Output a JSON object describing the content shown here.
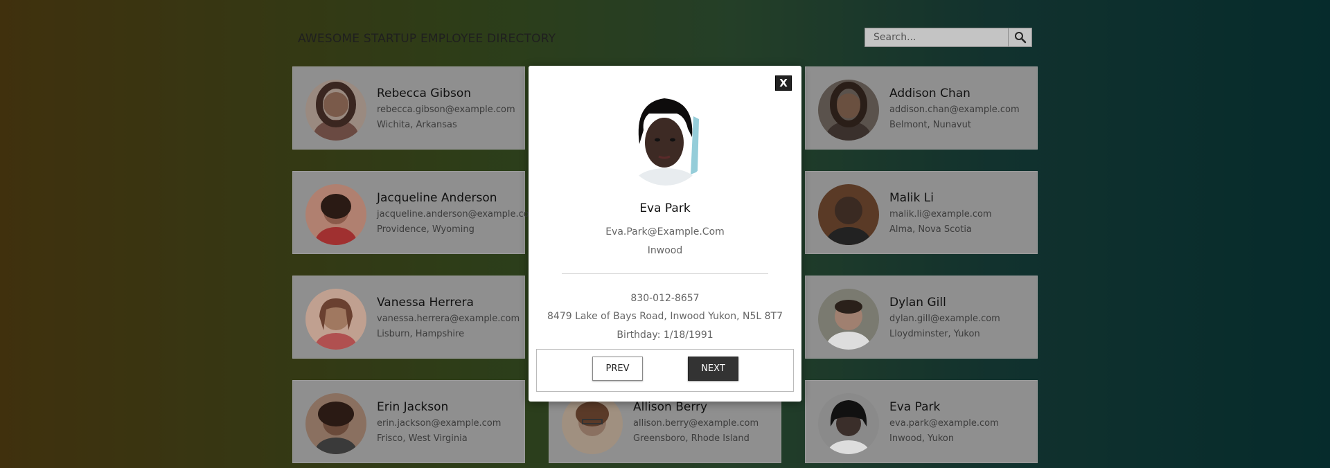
{
  "header": {
    "title": "AWESOME STARTUP EMPLOYEE DIRECTORY",
    "search_placeholder": "Search...",
    "search_icon": "magnifier-icon"
  },
  "employees": [
    {
      "name": "Rebecca Gibson",
      "email": "rebecca.gibson@example.com",
      "location": "Wichita, Arkansas",
      "avatar_color": "#7a5a4a"
    },
    {
      "name": "Addison Chan",
      "email": "addison.chan@example.com",
      "location": "Belmont, Nunavut",
      "avatar_color": "#4a3b33"
    },
    {
      "name": "Jacqueline Anderson",
      "email": "jacqueline.anderson@example.com",
      "location": "Providence, Wyoming",
      "avatar_color": "#8a5a4a"
    },
    {
      "name": "Malik Li",
      "email": "malik.li@example.com",
      "location": "Alma, Nova Scotia",
      "avatar_color": "#3a2a22"
    },
    {
      "name": "Vanessa Herrera",
      "email": "vanessa.herrera@example.com",
      "location": "Lisburn, Hampshire",
      "avatar_color": "#a07860"
    },
    {
      "name": "Dylan Gill",
      "email": "dylan.gill@example.com",
      "location": "Lloydminster, Yukon",
      "avatar_color": "#5e5248"
    },
    {
      "name": "Erin Jackson",
      "email": "erin.jackson@example.com",
      "location": "Frisco, West Virginia",
      "avatar_color": "#6a4a3a"
    },
    {
      "name": "Allison Berry",
      "email": "allison.berry@example.com",
      "location": "Greensboro, Rhode Island",
      "avatar_color": "#8a7060"
    },
    {
      "name": "Eva Park",
      "email": "eva.park@example.com",
      "location": "Inwood, Yukon",
      "avatar_color": "#3a2e2a"
    }
  ],
  "modal": {
    "close_label": "X",
    "name": "Eva Park",
    "email": "Eva.Park@Example.Com",
    "city": "Inwood",
    "phone": "830-012-8657",
    "address": "8479 Lake of Bays Road, Inwood Yukon, N5L 8T7",
    "birthday": "Birthday: 1/18/1991",
    "prev_label": "PREV",
    "next_label": "NEXT"
  }
}
